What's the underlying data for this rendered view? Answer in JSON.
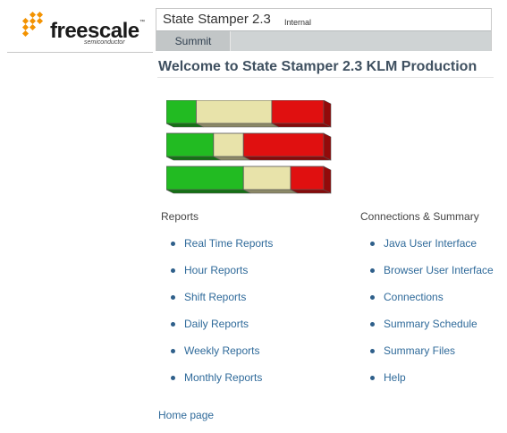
{
  "logo": {
    "wordmark": "freescale",
    "trademark": "™",
    "subtitle": "semiconductor"
  },
  "header": {
    "app_title": "State Stamper 2.3",
    "badge": "Internal",
    "nav_tabs": [
      {
        "label": "Summit"
      }
    ]
  },
  "main": {
    "page_title": "Welcome to State Stamper 2.3 KLM Production",
    "status_bars": [
      {
        "segments": [
          {
            "fraction": 0.19,
            "color": "#22bb22"
          },
          {
            "fraction": 0.48,
            "color": "#e8e3aa"
          },
          {
            "fraction": 0.33,
            "color": "#e01010"
          }
        ]
      },
      {
        "segments": [
          {
            "fraction": 0.3,
            "color": "#22bb22"
          },
          {
            "fraction": 0.19,
            "color": "#e8e3aa"
          },
          {
            "fraction": 0.51,
            "color": "#e01010"
          }
        ]
      },
      {
        "segments": [
          {
            "fraction": 0.49,
            "color": "#22bb22"
          },
          {
            "fraction": 0.3,
            "color": "#e8e3aa"
          },
          {
            "fraction": 0.21,
            "color": "#e01010"
          }
        ]
      }
    ]
  },
  "reports": {
    "heading": "Reports",
    "links": [
      {
        "label": "Real Time Reports"
      },
      {
        "label": "Hour Reports"
      },
      {
        "label": "Shift Reports"
      },
      {
        "label": "Daily Reports"
      },
      {
        "label": "Weekly Reports"
      },
      {
        "label": "Monthly Reports"
      }
    ]
  },
  "connections": {
    "heading": "Connections & Summary",
    "links": [
      {
        "label": "Java User Interface"
      },
      {
        "label": "Browser User Interface"
      },
      {
        "label": "Connections"
      },
      {
        "label": "Summary Schedule"
      },
      {
        "label": "Summary Files"
      },
      {
        "label": "Help"
      }
    ]
  },
  "footer": {
    "home_link": "Home page"
  },
  "colors": {
    "accent": "#2f6a9a",
    "title": "#3f5060",
    "nav_bg": "#c7cbcc",
    "logo_orange": "#f39200"
  }
}
